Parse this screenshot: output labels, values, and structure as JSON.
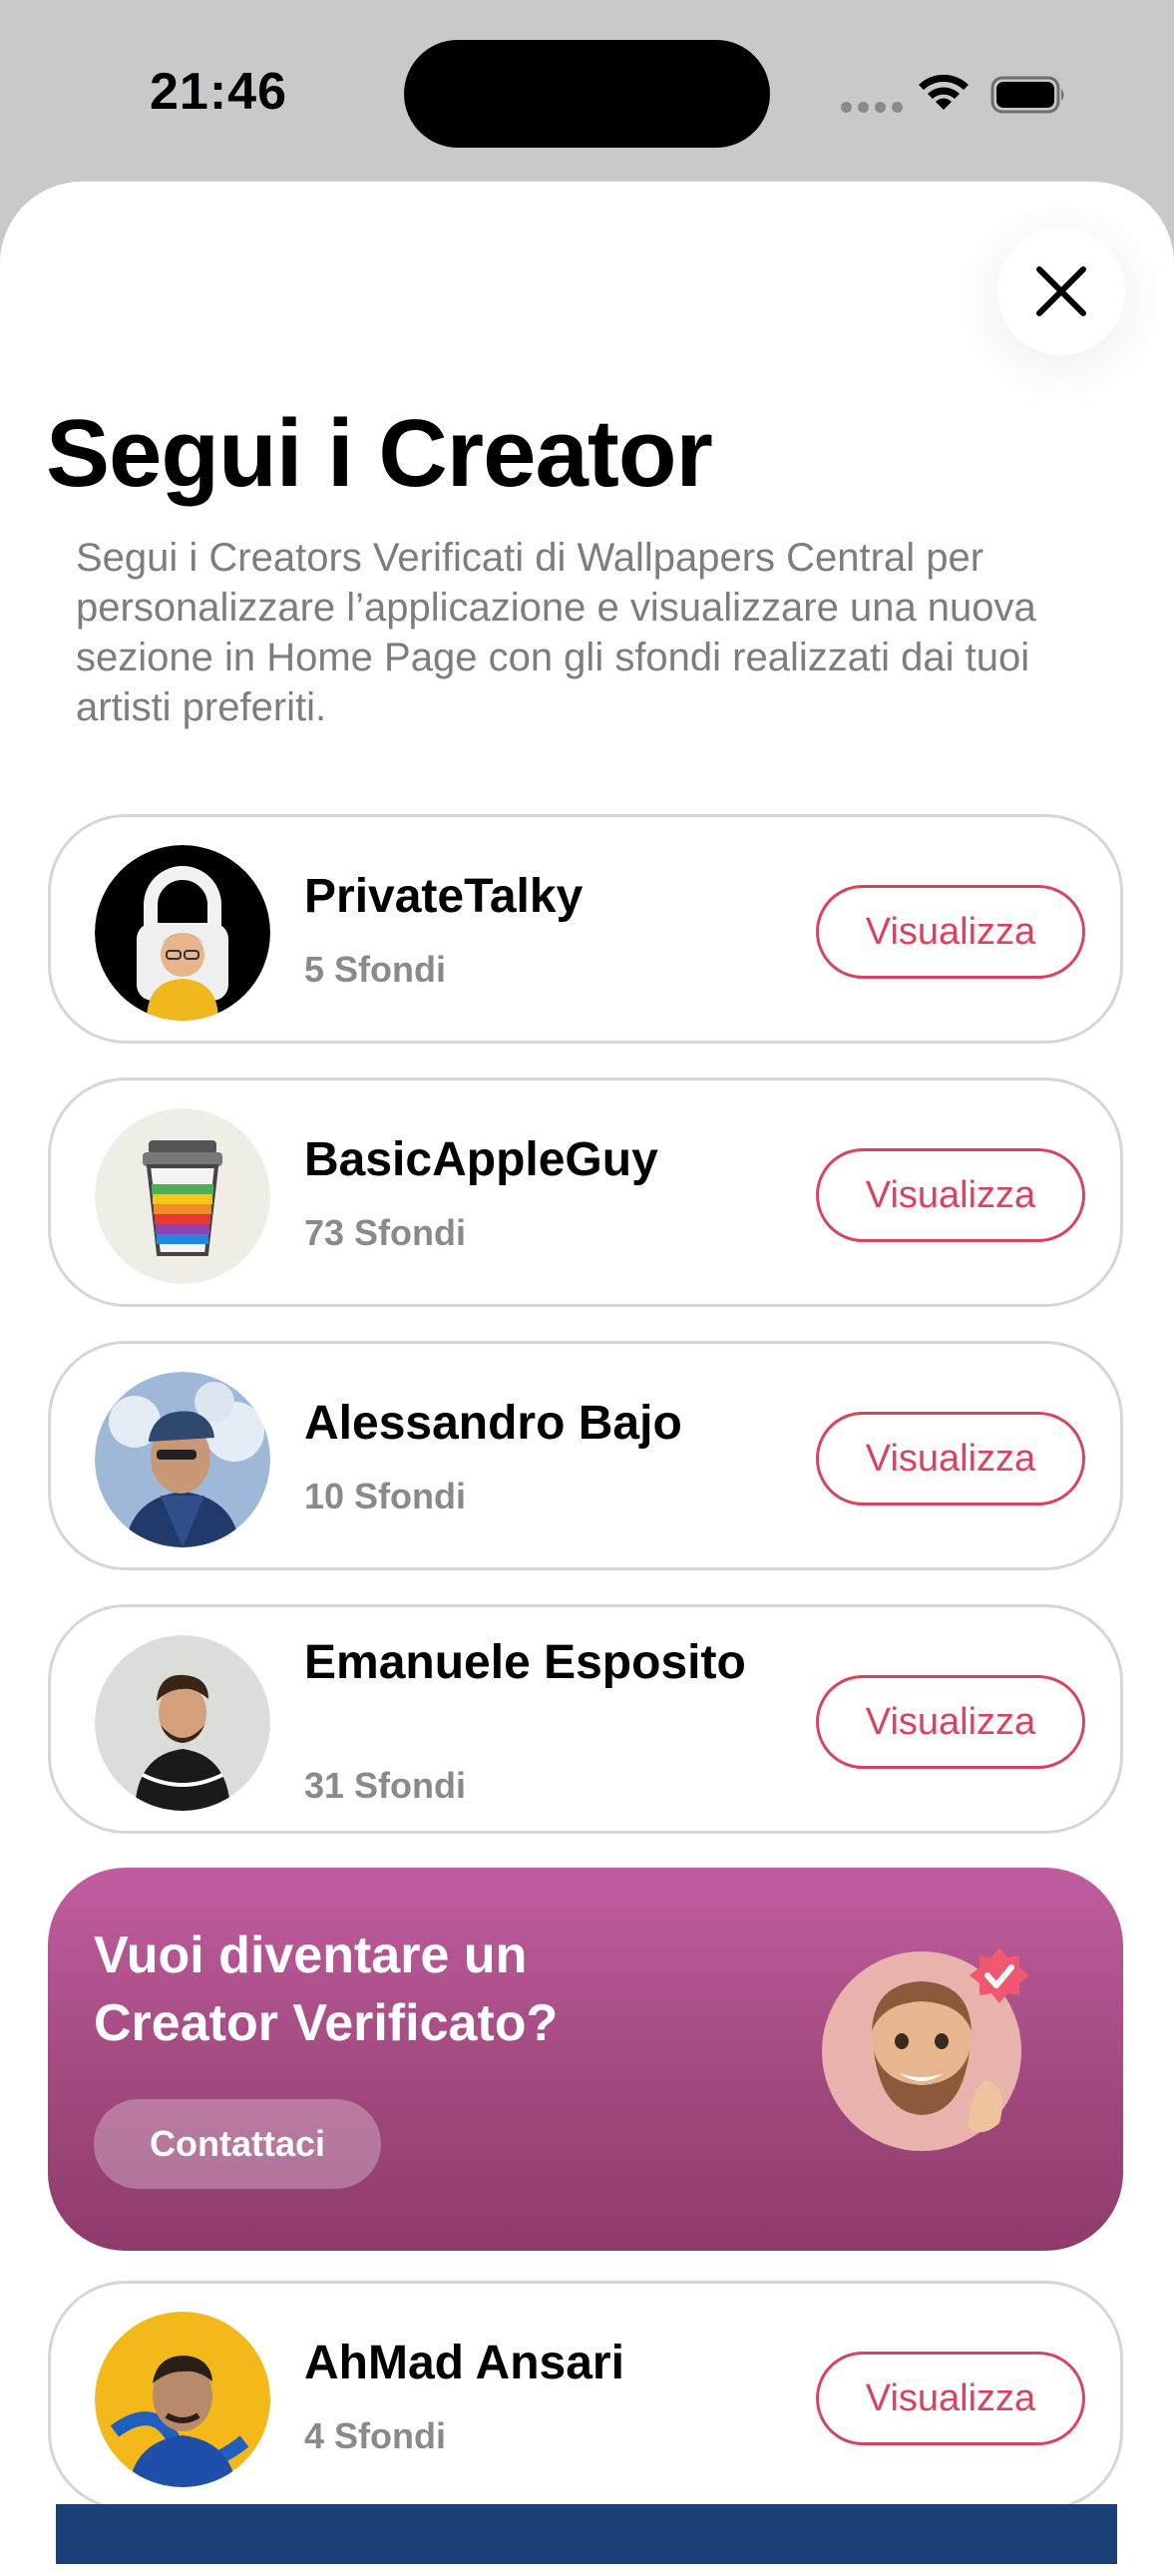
{
  "status_bar": {
    "time": "21:46",
    "icons": [
      "cellular-dots-icon",
      "wifi-icon",
      "battery-icon"
    ]
  },
  "sheet": {
    "close_icon": "close-icon",
    "title": "Segui i Creator",
    "subtitle": "Segui i Creators Verificati di Wallpapers Central per personalizzare l’applicazione e visualizzare una nuova sezione in Home Page con gli sfondi realizzati dai tuoi artisti preferiti."
  },
  "creators": [
    {
      "name": "PrivateTalky",
      "count": "5 Sfondi",
      "button": "Visualizza"
    },
    {
      "name": "BasicAppleGuy",
      "count": "73 Sfondi",
      "button": "Visualizza"
    },
    {
      "name": "Alessandro Bajo",
      "count": "10 Sfondi",
      "button": "Visualizza"
    },
    {
      "name": "Emanuele Esposito",
      "count": "31 Sfondi",
      "button": "Visualizza"
    },
    {
      "name": "AhMad Ansari",
      "count": "4 Sfondi",
      "button": "Visualizza"
    }
  ],
  "promo": {
    "title": "Vuoi diventare un Creator Verificato?",
    "button": "Contattaci",
    "badge_icon": "verified-check-icon"
  },
  "colors": {
    "accent": "#d8445e",
    "promo_top": "#c15d9f",
    "promo_bottom": "#8e3b6c",
    "secondary_text": "#7d7d80"
  }
}
